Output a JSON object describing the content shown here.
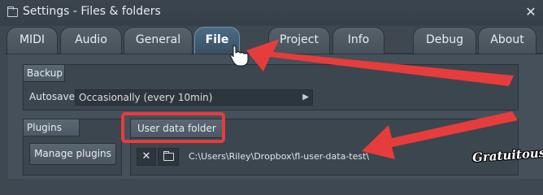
{
  "window": {
    "title": "Settings - Files & folders",
    "close_glyph": "✕"
  },
  "tabs": [
    {
      "label": "MIDI",
      "active": false
    },
    {
      "label": "Audio",
      "active": false
    },
    {
      "label": "General",
      "active": false
    },
    {
      "label": "File",
      "active": true
    },
    {
      "label": "Project",
      "active": false
    },
    {
      "label": "Info",
      "active": false
    },
    {
      "label": "Debug",
      "active": false
    },
    {
      "label": "About",
      "active": false
    }
  ],
  "backup": {
    "header": "Backup",
    "autosave_label": "Autosave",
    "autosave_value": "Occasionally (every 10min)",
    "dropdown_glyph": "▶"
  },
  "plugins": {
    "header": "Plugins",
    "manage_button": "Manage plugins"
  },
  "user_data_folder": {
    "header": "User data folder",
    "clear_glyph": "✕",
    "path": "C:\\Users\\Riley\\Dropbox\\fl-user-data-test\\"
  },
  "watermark": "Gratuitous",
  "colors": {
    "annotation": "#e73c3c",
    "active_tab": "#3f5a70"
  }
}
